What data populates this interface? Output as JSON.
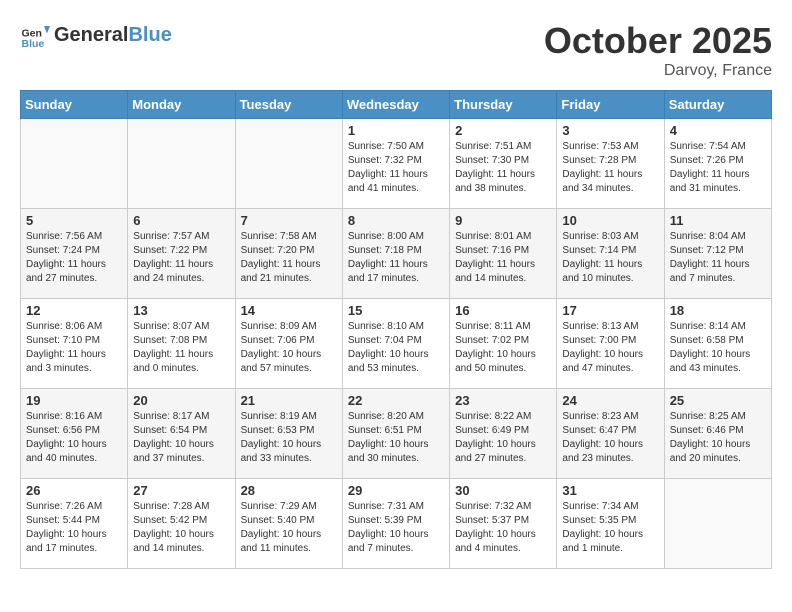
{
  "header": {
    "logo_line1": "General",
    "logo_line2": "Blue",
    "month": "October 2025",
    "location": "Darvoy, France"
  },
  "weekdays": [
    "Sunday",
    "Monday",
    "Tuesday",
    "Wednesday",
    "Thursday",
    "Friday",
    "Saturday"
  ],
  "weeks": [
    [
      {
        "day": "",
        "info": ""
      },
      {
        "day": "",
        "info": ""
      },
      {
        "day": "",
        "info": ""
      },
      {
        "day": "1",
        "info": "Sunrise: 7:50 AM\nSunset: 7:32 PM\nDaylight: 11 hours and 41 minutes."
      },
      {
        "day": "2",
        "info": "Sunrise: 7:51 AM\nSunset: 7:30 PM\nDaylight: 11 hours and 38 minutes."
      },
      {
        "day": "3",
        "info": "Sunrise: 7:53 AM\nSunset: 7:28 PM\nDaylight: 11 hours and 34 minutes."
      },
      {
        "day": "4",
        "info": "Sunrise: 7:54 AM\nSunset: 7:26 PM\nDaylight: 11 hours and 31 minutes."
      }
    ],
    [
      {
        "day": "5",
        "info": "Sunrise: 7:56 AM\nSunset: 7:24 PM\nDaylight: 11 hours and 27 minutes."
      },
      {
        "day": "6",
        "info": "Sunrise: 7:57 AM\nSunset: 7:22 PM\nDaylight: 11 hours and 24 minutes."
      },
      {
        "day": "7",
        "info": "Sunrise: 7:58 AM\nSunset: 7:20 PM\nDaylight: 11 hours and 21 minutes."
      },
      {
        "day": "8",
        "info": "Sunrise: 8:00 AM\nSunset: 7:18 PM\nDaylight: 11 hours and 17 minutes."
      },
      {
        "day": "9",
        "info": "Sunrise: 8:01 AM\nSunset: 7:16 PM\nDaylight: 11 hours and 14 minutes."
      },
      {
        "day": "10",
        "info": "Sunrise: 8:03 AM\nSunset: 7:14 PM\nDaylight: 11 hours and 10 minutes."
      },
      {
        "day": "11",
        "info": "Sunrise: 8:04 AM\nSunset: 7:12 PM\nDaylight: 11 hours and 7 minutes."
      }
    ],
    [
      {
        "day": "12",
        "info": "Sunrise: 8:06 AM\nSunset: 7:10 PM\nDaylight: 11 hours and 3 minutes."
      },
      {
        "day": "13",
        "info": "Sunrise: 8:07 AM\nSunset: 7:08 PM\nDaylight: 11 hours and 0 minutes."
      },
      {
        "day": "14",
        "info": "Sunrise: 8:09 AM\nSunset: 7:06 PM\nDaylight: 10 hours and 57 minutes."
      },
      {
        "day": "15",
        "info": "Sunrise: 8:10 AM\nSunset: 7:04 PM\nDaylight: 10 hours and 53 minutes."
      },
      {
        "day": "16",
        "info": "Sunrise: 8:11 AM\nSunset: 7:02 PM\nDaylight: 10 hours and 50 minutes."
      },
      {
        "day": "17",
        "info": "Sunrise: 8:13 AM\nSunset: 7:00 PM\nDaylight: 10 hours and 47 minutes."
      },
      {
        "day": "18",
        "info": "Sunrise: 8:14 AM\nSunset: 6:58 PM\nDaylight: 10 hours and 43 minutes."
      }
    ],
    [
      {
        "day": "19",
        "info": "Sunrise: 8:16 AM\nSunset: 6:56 PM\nDaylight: 10 hours and 40 minutes."
      },
      {
        "day": "20",
        "info": "Sunrise: 8:17 AM\nSunset: 6:54 PM\nDaylight: 10 hours and 37 minutes."
      },
      {
        "day": "21",
        "info": "Sunrise: 8:19 AM\nSunset: 6:53 PM\nDaylight: 10 hours and 33 minutes."
      },
      {
        "day": "22",
        "info": "Sunrise: 8:20 AM\nSunset: 6:51 PM\nDaylight: 10 hours and 30 minutes."
      },
      {
        "day": "23",
        "info": "Sunrise: 8:22 AM\nSunset: 6:49 PM\nDaylight: 10 hours and 27 minutes."
      },
      {
        "day": "24",
        "info": "Sunrise: 8:23 AM\nSunset: 6:47 PM\nDaylight: 10 hours and 23 minutes."
      },
      {
        "day": "25",
        "info": "Sunrise: 8:25 AM\nSunset: 6:46 PM\nDaylight: 10 hours and 20 minutes."
      }
    ],
    [
      {
        "day": "26",
        "info": "Sunrise: 7:26 AM\nSunset: 5:44 PM\nDaylight: 10 hours and 17 minutes."
      },
      {
        "day": "27",
        "info": "Sunrise: 7:28 AM\nSunset: 5:42 PM\nDaylight: 10 hours and 14 minutes."
      },
      {
        "day": "28",
        "info": "Sunrise: 7:29 AM\nSunset: 5:40 PM\nDaylight: 10 hours and 11 minutes."
      },
      {
        "day": "29",
        "info": "Sunrise: 7:31 AM\nSunset: 5:39 PM\nDaylight: 10 hours and 7 minutes."
      },
      {
        "day": "30",
        "info": "Sunrise: 7:32 AM\nSunset: 5:37 PM\nDaylight: 10 hours and 4 minutes."
      },
      {
        "day": "31",
        "info": "Sunrise: 7:34 AM\nSunset: 5:35 PM\nDaylight: 10 hours and 1 minute."
      },
      {
        "day": "",
        "info": ""
      }
    ]
  ]
}
